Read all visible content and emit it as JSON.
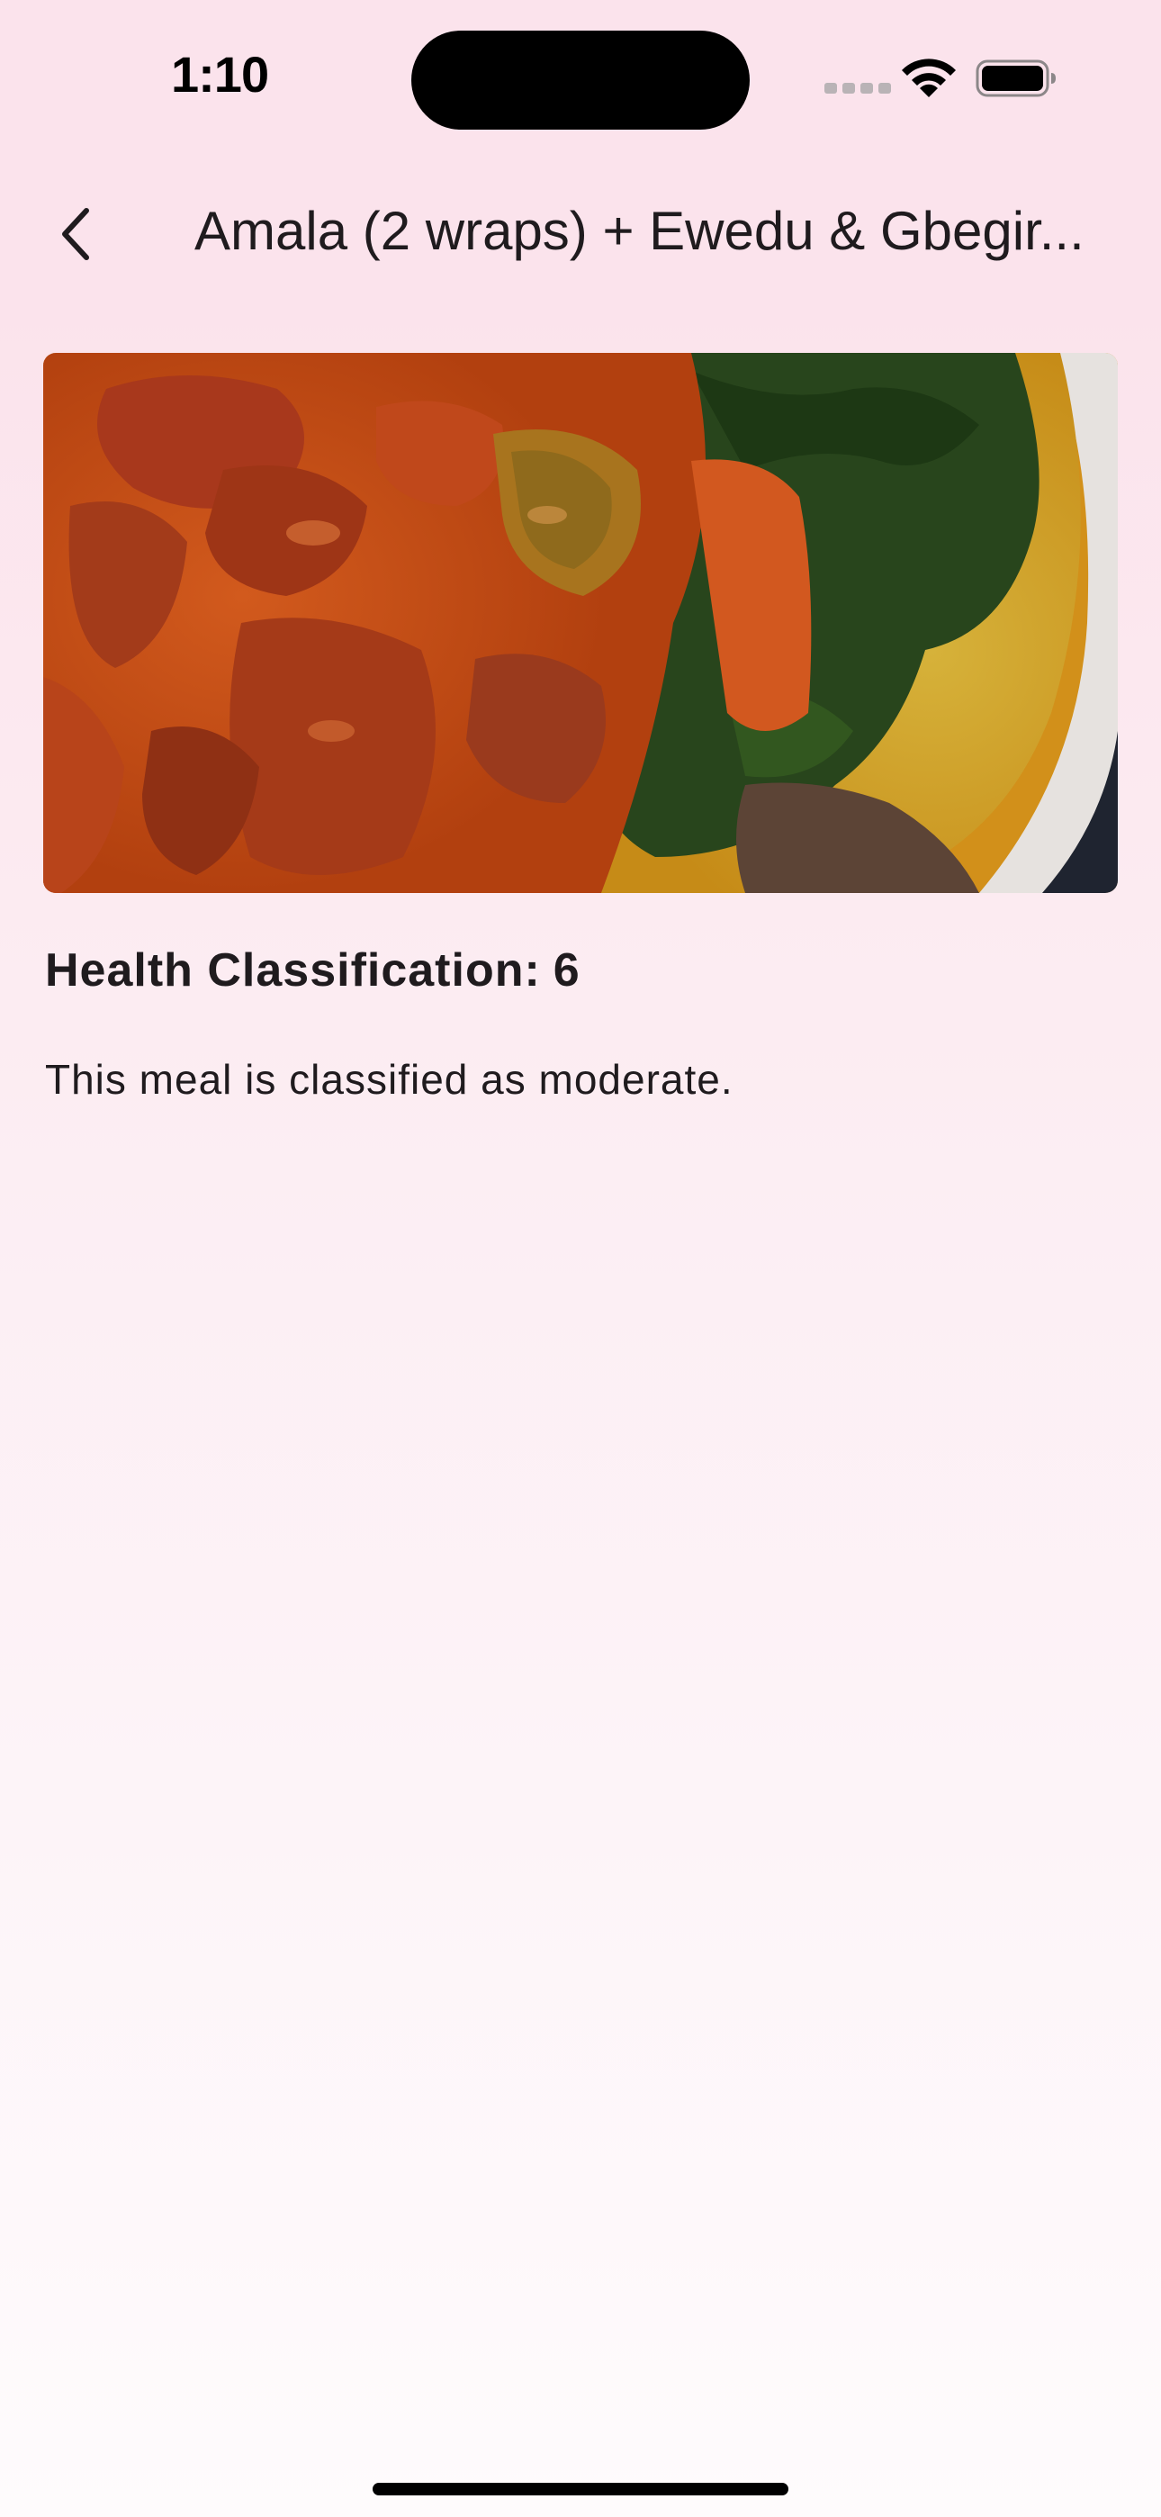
{
  "status_bar": {
    "time": "1:10"
  },
  "app_bar": {
    "title": "Amala (2  wraps) + Ewedu & Gbegir..."
  },
  "meal": {
    "health_label": "Health Classification:",
    "health_score": "6",
    "description": "This meal is classified as moderate."
  }
}
